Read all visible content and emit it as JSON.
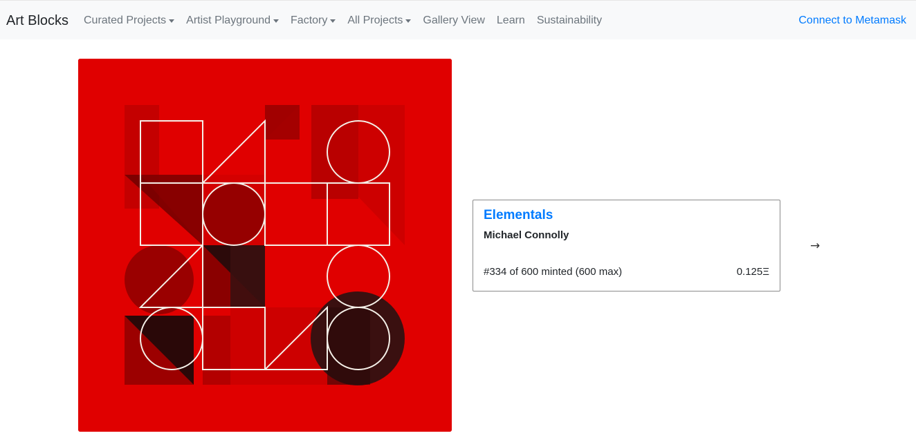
{
  "navbar": {
    "brand": "Art Blocks",
    "items": [
      {
        "label": "Curated Projects",
        "dropdown": true
      },
      {
        "label": "Artist Playground",
        "dropdown": true
      },
      {
        "label": "Factory",
        "dropdown": true
      },
      {
        "label": "All Projects",
        "dropdown": true
      },
      {
        "label": "Gallery View",
        "dropdown": false
      },
      {
        "label": "Learn",
        "dropdown": false
      },
      {
        "label": "Sustainability",
        "dropdown": false
      }
    ],
    "connect_label": "Connect to Metamask"
  },
  "project": {
    "title": "Elementals",
    "artist": "Michael Connolly",
    "minted_text": "#334 of 600 minted (600 max)",
    "price": "0.125Ξ"
  },
  "next_arrow": "→",
  "colors": {
    "art_background": "#e00000",
    "link": "#007bff",
    "nav_text": "#6c757d",
    "navbar_bg": "#f8f9fa"
  }
}
